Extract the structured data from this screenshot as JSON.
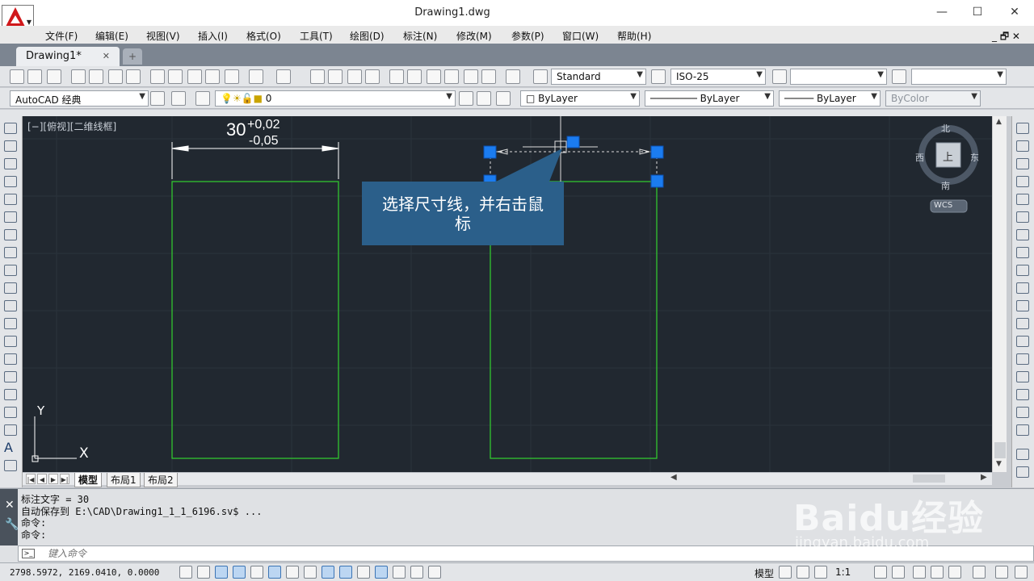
{
  "window": {
    "title": "Drawing1.dwg",
    "minimize": "—",
    "maximize": "☐",
    "close": "✕"
  },
  "menu": [
    "文件(F)",
    "编辑(E)",
    "视图(V)",
    "插入(I)",
    "格式(O)",
    "工具(T)",
    "绘图(D)",
    "标注(N)",
    "修改(M)",
    "参数(P)",
    "窗口(W)",
    "帮助(H)"
  ],
  "mdi_controls": "_ 🗗 ✕",
  "tabs": {
    "active": "Drawing1*",
    "close": "✕",
    "new": "+"
  },
  "toolbar": {
    "text_style": "Standard",
    "dim_style": "ISO-25",
    "table_style": "",
    "multileader_style": "",
    "workspace": "AutoCAD 经典",
    "layer": "0",
    "color": "ByLayer",
    "linetype": "ByLayer",
    "lineweight": "ByLayer",
    "plotstyle": "ByColor"
  },
  "viewport": {
    "label": "[−][俯视][二维线框]"
  },
  "dimension": {
    "base": "30",
    "upper": "+0,02",
    "lower": "-0,05"
  },
  "viewcube": {
    "north": "北",
    "south": "南",
    "east": "东",
    "west": "西",
    "top": "上",
    "wcs": "WCS"
  },
  "ucs": {
    "x": "X",
    "y": "Y"
  },
  "callout": {
    "line1": "选择尺寸线，并右击鼠",
    "line2": "标"
  },
  "layout_tabs": [
    "模型",
    "布局1",
    "布局2"
  ],
  "command": {
    "history": [
      "标注文字 = 30",
      "自动保存到 E:\\CAD\\Drawing1_1_1_6196.sv$ ...",
      "命令:",
      "命令:"
    ],
    "placeholder": "键入命令"
  },
  "status": {
    "coords": "2798.5972, 2169.0410, 0.0000",
    "model": "模型",
    "scale": "1:1"
  },
  "watermark": {
    "brand": "Baidu经验",
    "url": "jingyan.baidu.com"
  },
  "colors": {
    "canvas": "#212830",
    "geometry": "#32d22f",
    "grip": "#1b7cf0",
    "callout": "#2b5f8a",
    "dimension": "#ffffff"
  }
}
